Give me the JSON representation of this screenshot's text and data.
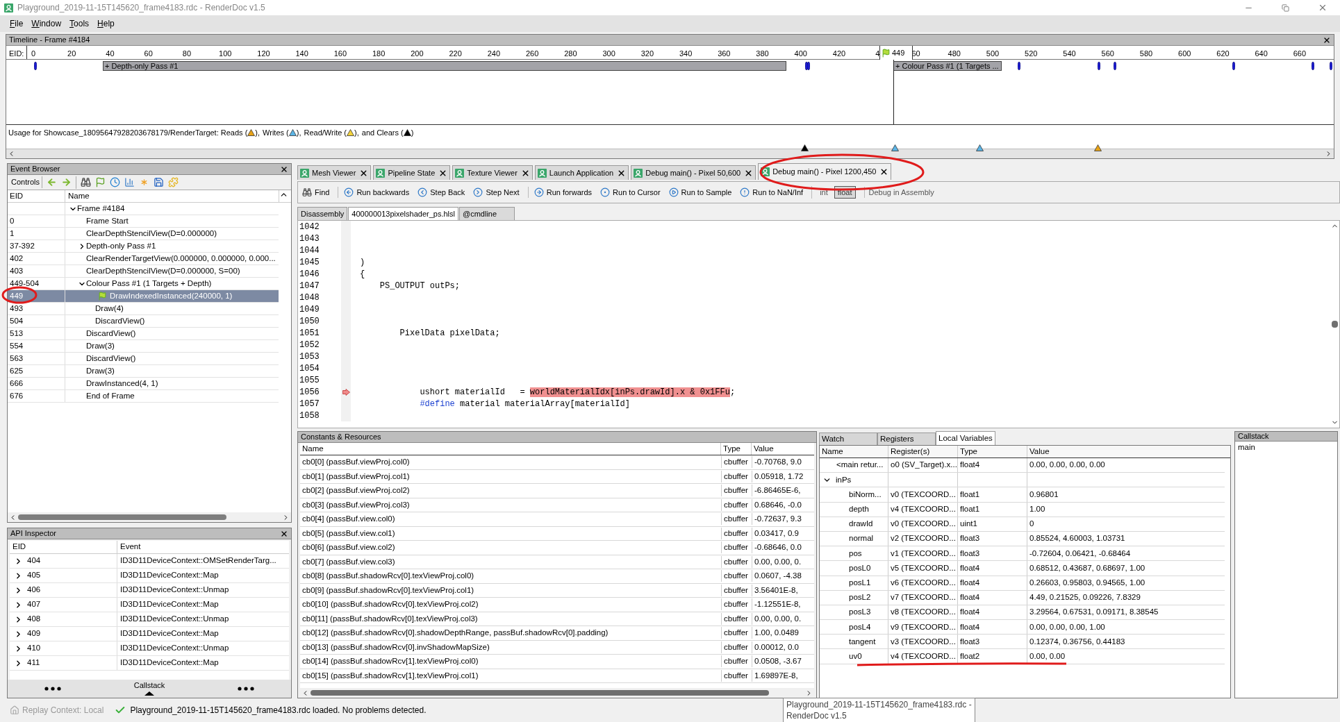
{
  "window": {
    "title": "Playground_2019-11-15T145620_frame4183.rdc - RenderDoc v1.5"
  },
  "menu": [
    "File",
    "Window",
    "Tools",
    "Help"
  ],
  "timeline": {
    "title": "Timeline - Frame #4184",
    "eid_label": "EID:",
    "ticks": [
      "0",
      "20",
      "40",
      "60",
      "80",
      "100",
      "120",
      "140",
      "160",
      "180",
      "200",
      "220",
      "240",
      "260",
      "280",
      "300",
      "320",
      "340",
      "360",
      "380",
      "400",
      "420",
      "4",
      "60",
      "480",
      "500",
      "520",
      "540",
      "560",
      "580",
      "600",
      "620",
      "640",
      "660"
    ],
    "current_marker": "449",
    "passes": [
      {
        "label": "+ Depth-only Pass #1"
      },
      {
        "label": "+ Colour Pass #1 (1 Targets ..."
      }
    ],
    "usage_lead": "Usage for Showcase_18095647928203678179/RenderTarget:",
    "legend": [
      {
        "kind": "read",
        "before": "Reads (",
        "after": "),"
      },
      {
        "kind": "write",
        "before": "Writes (",
        "after": "),"
      },
      {
        "kind": "read_write",
        "before": "Read/Write (",
        "after": "),"
      },
      {
        "kind": "clear",
        "before": "and Clears (",
        "after": ")"
      }
    ],
    "usage_markers": [
      {
        "kind": "clear"
      },
      {
        "kind": "write"
      },
      {
        "kind": "write"
      },
      {
        "kind": "read"
      }
    ]
  },
  "event_browser": {
    "title": "Event Browser",
    "controls_label": "Controls",
    "columns": [
      "EID",
      "Name"
    ],
    "events": [
      {
        "name": "Frame #4184",
        "expanded": true,
        "selected": false,
        "children": [
          {
            "eid": "0",
            "name": "Frame Start",
            "selected": false
          },
          {
            "eid": "1",
            "name": "ClearDepthStencilView(D=0.000000)",
            "selected": false
          },
          {
            "eid": "37-392",
            "name": "Depth-only Pass #1",
            "expanded": false,
            "selected": false
          },
          {
            "eid": "402",
            "name": "ClearRenderTargetView(0.000000, 0.000000, 0.000...",
            "selected": false
          },
          {
            "eid": "403",
            "name": "ClearDepthStencilView(D=0.000000, S=00)",
            "selected": false
          },
          {
            "eid": "449-504",
            "name": "Colour Pass #1 (1 Targets + Depth)",
            "expanded": true,
            "selected": false,
            "children": [
              {
                "eid": "449",
                "name": "DrawIndexedInstanced(240000, 1)",
                "selected": true
              },
              {
                "eid": "493",
                "name": "Draw(4)",
                "selected": false
              },
              {
                "eid": "504",
                "name": "DiscardView()",
                "selected": false
              }
            ]
          },
          {
            "eid": "513",
            "name": "DiscardView()",
            "selected": false
          },
          {
            "eid": "554",
            "name": "Draw(3)",
            "selected": false
          },
          {
            "eid": "563",
            "name": "DiscardView()",
            "selected": false
          },
          {
            "eid": "625",
            "name": "Draw(3)",
            "selected": false
          },
          {
            "eid": "666",
            "name": "DrawInstanced(4, 1)",
            "selected": false
          },
          {
            "eid": "676",
            "name": "End of Frame",
            "selected": false
          }
        ]
      }
    ]
  },
  "api_inspector": {
    "title": "API Inspector",
    "columns": [
      "EID",
      "Event"
    ],
    "rows": [
      {
        "eid": "404",
        "event": "ID3D11DeviceContext::OMSetRenderTarg...",
        "expanded": false
      },
      {
        "eid": "405",
        "event": "ID3D11DeviceContext::Map",
        "expanded": false
      },
      {
        "eid": "406",
        "event": "ID3D11DeviceContext::Unmap",
        "expanded": false
      },
      {
        "eid": "407",
        "event": "ID3D11DeviceContext::Map",
        "expanded": false
      },
      {
        "eid": "408",
        "event": "ID3D11DeviceContext::Unmap",
        "expanded": false
      },
      {
        "eid": "409",
        "event": "ID3D11DeviceContext::Map",
        "expanded": false
      },
      {
        "eid": "410",
        "event": "ID3D11DeviceContext::Unmap",
        "expanded": false
      },
      {
        "eid": "411",
        "event": "ID3D11DeviceContext::Map",
        "expanded": false
      }
    ]
  },
  "callstack_toggle": {
    "label": "Callstack"
  },
  "tabs": [
    {
      "label": "Mesh Viewer",
      "selected": false
    },
    {
      "label": "Pipeline State",
      "selected": false
    },
    {
      "label": "Texture Viewer",
      "selected": false
    },
    {
      "label": "Launch Application",
      "selected": false
    },
    {
      "label": "Debug main() - Pixel 50,600",
      "selected": false
    },
    {
      "label": "Debug main() - Pixel 1200,450",
      "selected": true
    }
  ],
  "debug_toolbar": {
    "buttons": [
      {
        "kind": "find",
        "label": "Find"
      },
      {
        "kind": "run_backwards",
        "label": "Run backwards"
      },
      {
        "kind": "step_back",
        "label": "Step Back"
      },
      {
        "kind": "step_next",
        "label": "Step Next"
      },
      {
        "kind": "run_forwards",
        "label": "Run forwards"
      },
      {
        "kind": "run_to_cursor",
        "label": "Run to Cursor"
      },
      {
        "kind": "run_to_sample",
        "label": "Run to Sample"
      },
      {
        "kind": "run_to_nan",
        "label": "Run to NaN/Inf"
      }
    ],
    "modes": [
      {
        "label": "int",
        "selected": false
      },
      {
        "label": "float",
        "selected": true
      }
    ],
    "assembly": {
      "label": "Debug in Assembly",
      "disabled": true
    }
  },
  "source_tabs": [
    {
      "label": "Disassembly",
      "selected": false
    },
    {
      "label": "400000013pixelshader_ps.hlsl",
      "selected": true
    },
    {
      "label": "@cmdline",
      "selected": false
    }
  ],
  "code_lines": [
    {
      "number": "1042",
      "current": false
    },
    {
      "number": "1043",
      "current": false
    },
    {
      "number": "1044",
      "current": false
    },
    {
      "number": "1045",
      "code": ")",
      "current": false
    },
    {
      "number": "1046",
      "code": "{",
      "current": false
    },
    {
      "number": "1047",
      "code": "    PS_OUTPUT outPs;",
      "current": false
    },
    {
      "number": "1048",
      "current": false
    },
    {
      "number": "1049",
      "current": false
    },
    {
      "number": "1050",
      "current": false
    },
    {
      "number": "1051",
      "code": "        PixelData pixelData;",
      "current": false
    },
    {
      "number": "1052",
      "current": false
    },
    {
      "number": "1053",
      "current": false
    },
    {
      "number": "1054",
      "current": false
    },
    {
      "number": "1055",
      "current": false
    },
    {
      "number": "1056",
      "code": "            ushort materialId   = ",
      "highlight": "worldMaterialIdx[inPs.drawId].x & 0x1FFu",
      "after": ";",
      "current": true
    },
    {
      "number": "1057",
      "keyword": "            #define",
      "after": " material materialArray[materialId]",
      "current": false
    },
    {
      "number": "1058",
      "current": false
    }
  ],
  "constants": {
    "title": "Constants & Resources",
    "columns": [
      "Name",
      "Type",
      "Value"
    ],
    "rows": [
      {
        "name": "cb0[0] (passBuf.viewProj.col0)",
        "type": "cbuffer",
        "value": "-0.70768, 9.0"
      },
      {
        "name": "cb0[1] (passBuf.viewProj.col1)",
        "type": "cbuffer",
        "value": "0.05918, 1.72"
      },
      {
        "name": "cb0[2] (passBuf.viewProj.col2)",
        "type": "cbuffer",
        "value": "-6.86465E-6,"
      },
      {
        "name": "cb0[3] (passBuf.viewProj.col3)",
        "type": "cbuffer",
        "value": "0.68646, -0.0"
      },
      {
        "name": "cb0[4] (passBuf.view.col0)",
        "type": "cbuffer",
        "value": "-0.72637, 9.3"
      },
      {
        "name": "cb0[5] (passBuf.view.col1)",
        "type": "cbuffer",
        "value": "0.03417, 0.9"
      },
      {
        "name": "cb0[6] (passBuf.view.col2)",
        "type": "cbuffer",
        "value": "-0.68646, 0.0"
      },
      {
        "name": "cb0[7] (passBuf.view.col3)",
        "type": "cbuffer",
        "value": "0.00, 0.00, 0."
      },
      {
        "name": "cb0[8] (passBuf.shadowRcv[0].texViewProj.col0)",
        "type": "cbuffer",
        "value": "0.0607, -4.38"
      },
      {
        "name": "cb0[9] (passBuf.shadowRcv[0].texViewProj.col1)",
        "type": "cbuffer",
        "value": "3.56401E-8,"
      },
      {
        "name": "cb0[10] (passBuf.shadowRcv[0].texViewProj.col2)",
        "type": "cbuffer",
        "value": "-1.12551E-8,"
      },
      {
        "name": "cb0[11] (passBuf.shadowRcv[0].texViewProj.col3)",
        "type": "cbuffer",
        "value": "0.00, 0.00, 0."
      },
      {
        "name": "cb0[12] (passBuf.shadowRcv[0].shadowDepthRange, passBuf.shadowRcv[0].padding)",
        "type": "cbuffer",
        "value": "1.00, 0.0489"
      },
      {
        "name": "cb0[13] (passBuf.shadowRcv[0].invShadowMapSize)",
        "type": "cbuffer",
        "value": "0.00012, 0.0"
      },
      {
        "name": "cb0[14] (passBuf.shadowRcv[1].texViewProj.col0)",
        "type": "cbuffer",
        "value": "0.0508, -3.67"
      },
      {
        "name": "cb0[15] (passBuf.shadowRcv[1].texViewProj.col1)",
        "type": "cbuffer",
        "value": "1.69897E-8,"
      }
    ]
  },
  "variables": {
    "tabs": [
      {
        "label": "Watch",
        "selected": false
      },
      {
        "label": "Registers",
        "selected": false
      },
      {
        "label": "Local Variables",
        "selected": true
      }
    ],
    "columns": [
      "Name",
      "Register(s)",
      "Type",
      "Value"
    ],
    "rows": [
      {
        "name": "<main retur...",
        "register": "o0 (SV_Target).x...",
        "type": "float4",
        "value": "0.00, 0.00, 0.00, 0.00"
      },
      {
        "name": "inPs",
        "expanded": true,
        "children": [
          {
            "name": "biNorm...",
            "register": "v0 (TEXCOORD...",
            "type": "float1",
            "value": "0.96801"
          },
          {
            "name": "depth",
            "register": "v4 (TEXCOORD...",
            "type": "float1",
            "value": "1.00"
          },
          {
            "name": "drawId",
            "register": "v0 (TEXCOORD...",
            "type": "uint1",
            "value": "0"
          },
          {
            "name": "normal",
            "register": "v2 (TEXCOORD...",
            "type": "float3",
            "value": "0.85524, 4.60003, 1.03731"
          },
          {
            "name": "pos",
            "register": "v1 (TEXCOORD...",
            "type": "float3",
            "value": "-0.72604, 0.06421, -0.68464"
          },
          {
            "name": "posL0",
            "register": "v5 (TEXCOORD...",
            "type": "float4",
            "value": "0.68512, 0.43687, 0.68697, 1.00"
          },
          {
            "name": "posL1",
            "register": "v6 (TEXCOORD...",
            "type": "float4",
            "value": "0.26603, 0.95803, 0.94565, 1.00"
          },
          {
            "name": "posL2",
            "register": "v7 (TEXCOORD...",
            "type": "float4",
            "value": "4.49, 0.21525, 0.09226, 7.8329"
          },
          {
            "name": "posL3",
            "register": "v8 (TEXCOORD...",
            "type": "float4",
            "value": "3.29564, 0.67531, 0.09171, 8.38545"
          },
          {
            "name": "posL4",
            "register": "v9 (TEXCOORD...",
            "type": "float4",
            "value": "0.00, 0.00, 0.00, 1.00"
          },
          {
            "name": "tangent",
            "register": "v3 (TEXCOORD...",
            "type": "float3",
            "value": "0.12374, 0.36756, 0.44183"
          },
          {
            "name": "uv0",
            "register": "v4 (TEXCOORD...",
            "type": "float2",
            "value": "0.00, 0.00"
          }
        ]
      }
    ]
  },
  "callstack": {
    "title": "Callstack",
    "frames": [
      "main"
    ]
  },
  "status_bar": {
    "replay_context": "Replay Context: Local",
    "message": "Playground_2019-11-15T145620_frame4183.rdc loaded. No problems detected."
  },
  "tooltip": {
    "lines": [
      "Playground_2019-11-15T145620_frame4183.rdc -",
      "RenderDoc v1.5"
    ]
  }
}
